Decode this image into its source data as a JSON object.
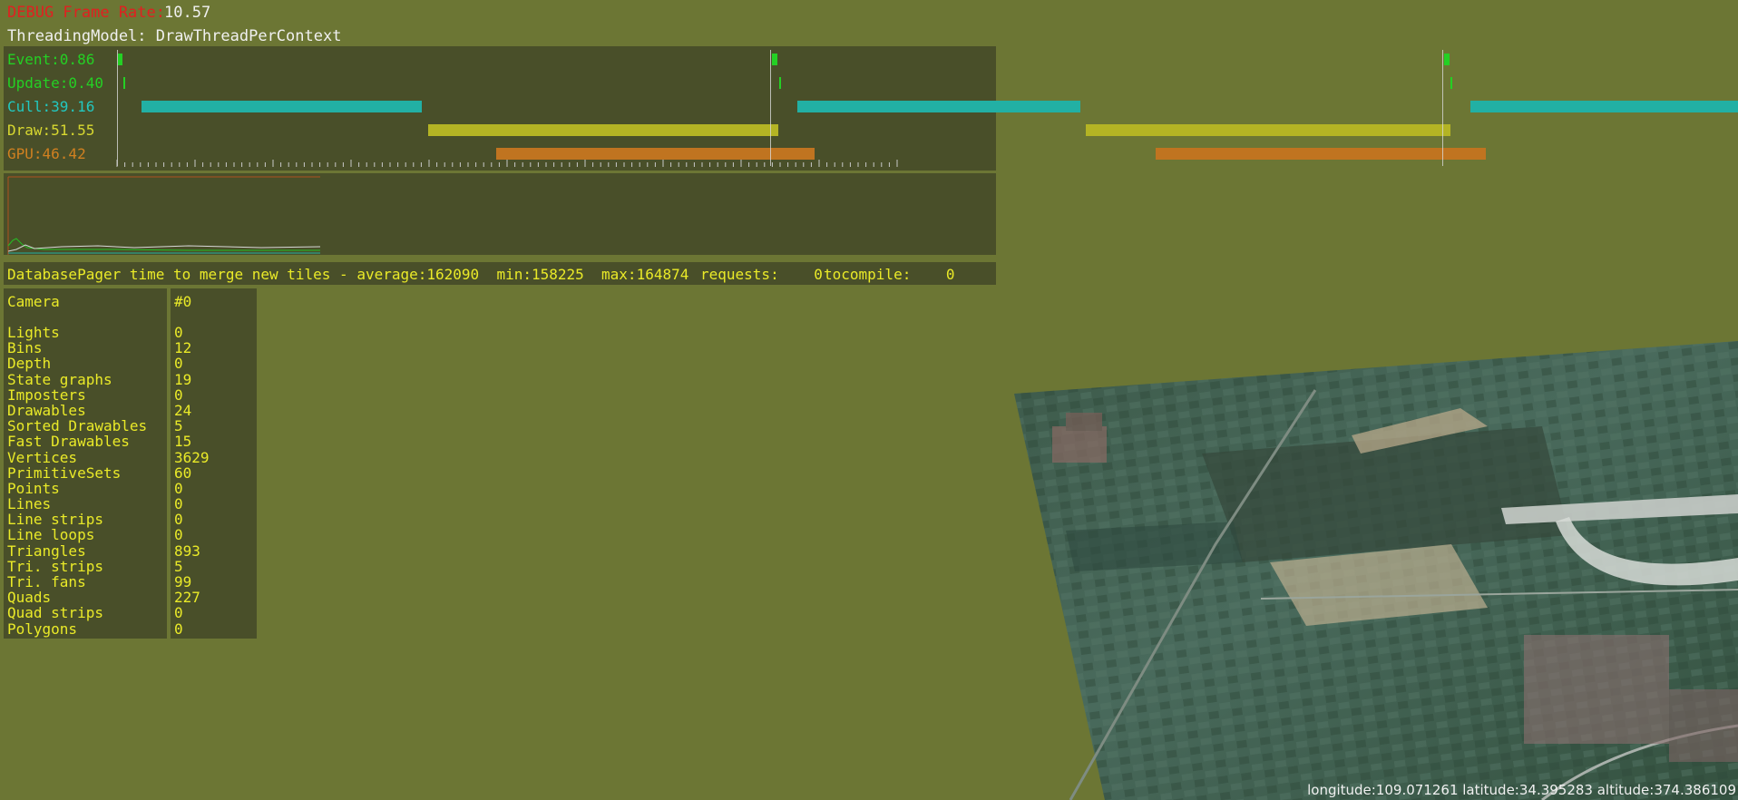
{
  "debug": {
    "frame_rate_label": "DEBUG Frame Rate:",
    "frame_rate_value": "10.57",
    "threading_model": "ThreadingModel: DrawThreadPerContext"
  },
  "timeline": {
    "rows": [
      {
        "label": "Event:0.86",
        "color": "#24d024"
      },
      {
        "label": "Update:0.40",
        "color": "#24d024"
      },
      {
        "label": "Cull:39.16",
        "color": "#22b8b0"
      },
      {
        "label": "Draw:51.55",
        "color": "#c8c828"
      },
      {
        "label": "GPU:46.42",
        "color": "#d08020"
      }
    ]
  },
  "pager": {
    "merge_text": "DatabasePager time to merge new tiles - average:162090  min:158225  max:164874",
    "requests_text": "requests:    0",
    "tocompile_text": "tocompile:    0"
  },
  "camera_stats": {
    "header_name": "Camera",
    "header_value": "#0",
    "rows": [
      {
        "name": "Lights",
        "value": "0"
      },
      {
        "name": "Bins",
        "value": "12"
      },
      {
        "name": "Depth",
        "value": "0"
      },
      {
        "name": "State graphs",
        "value": "19"
      },
      {
        "name": "Imposters",
        "value": "0"
      },
      {
        "name": "Drawables",
        "value": "24"
      },
      {
        "name": "Sorted Drawables",
        "value": "5"
      },
      {
        "name": "Fast Drawables",
        "value": "15"
      },
      {
        "name": "Vertices",
        "value": "3629"
      },
      {
        "name": "PrimitiveSets",
        "value": "60"
      },
      {
        "name": "Points",
        "value": "0"
      },
      {
        "name": "Lines",
        "value": "0"
      },
      {
        "name": "Line strips",
        "value": "0"
      },
      {
        "name": "Line loops",
        "value": "0"
      },
      {
        "name": "Triangles",
        "value": "893"
      },
      {
        "name": "Tri. strips",
        "value": "5"
      },
      {
        "name": "Tri. fans",
        "value": "99"
      },
      {
        "name": "Quads",
        "value": "227"
      },
      {
        "name": "Quad strips",
        "value": "0"
      },
      {
        "name": "Polygons",
        "value": "0"
      }
    ]
  },
  "coordinates": {
    "text": "longitude:109.071261 latitude:34.395283 altitude:374.386109"
  },
  "colors": {
    "background": "#6c7634",
    "debug_red": "#e02020",
    "text_white": "#f0f0f0",
    "stats_yellow": "#eaea28"
  }
}
